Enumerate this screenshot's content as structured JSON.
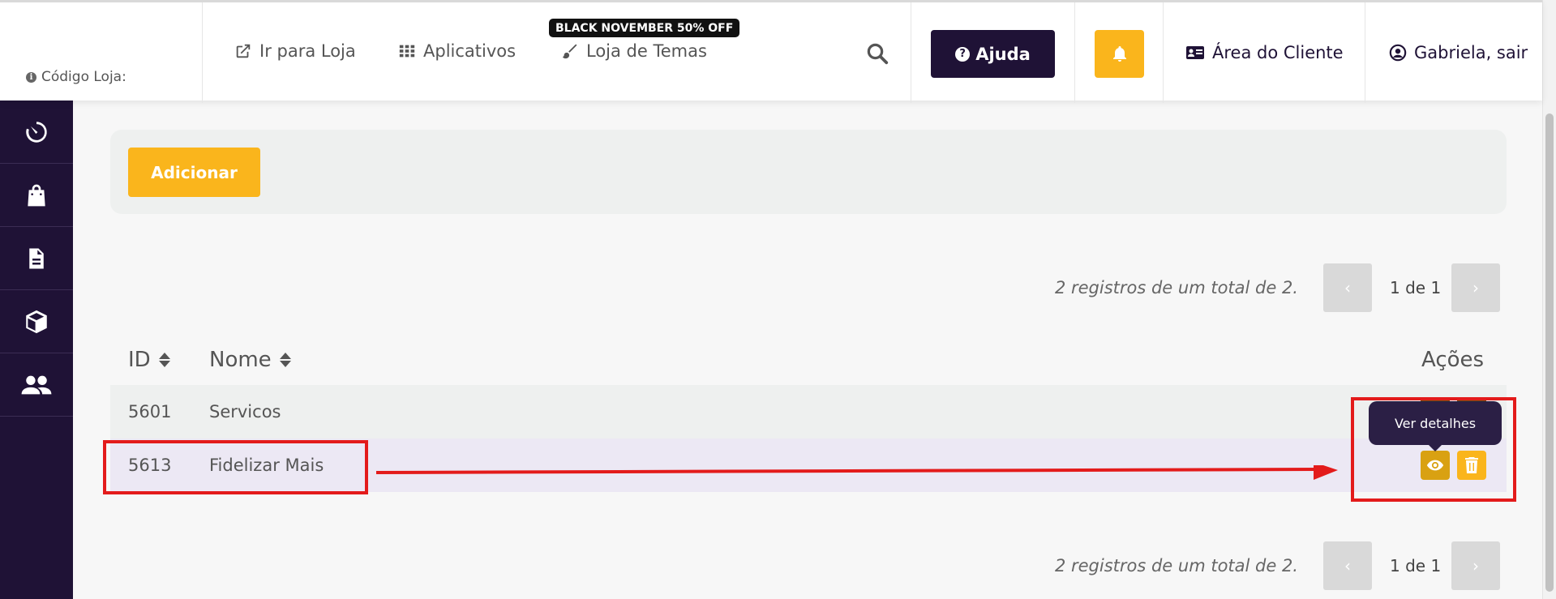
{
  "header": {
    "store_code_label": "Código Loja:",
    "nav": [
      {
        "label": "Ir para Loja",
        "icon": "external-link-icon"
      },
      {
        "label": "Aplicativos",
        "icon": "grid-icon"
      },
      {
        "label": "Loja de Temas",
        "icon": "brush-icon"
      }
    ],
    "promo_badge": "BLACK NOVEMBER 50% OFF",
    "help_label": "Ajuda",
    "client_area_label": "Área do Cliente",
    "user_label": "Gabriela, sair"
  },
  "sidebar": {
    "items": [
      {
        "icon": "dashboard-timer-icon"
      },
      {
        "icon": "shopping-bag-icon"
      },
      {
        "icon": "document-icon"
      },
      {
        "icon": "box-icon"
      },
      {
        "icon": "users-icon"
      }
    ]
  },
  "main": {
    "add_label": "Adicionar",
    "pagination": {
      "summary": "2 registros de um total de 2.",
      "page_text": "1 de 1",
      "prev": "‹",
      "next": "›"
    },
    "table": {
      "columns": [
        "ID",
        "Nome",
        "Ações"
      ],
      "rows": [
        {
          "id": "5601",
          "name": "Servicos"
        },
        {
          "id": "5613",
          "name": "Fidelizar Mais"
        }
      ]
    },
    "tooltip": "Ver detalhes"
  },
  "colors": {
    "brand_dark": "#1f1236",
    "accent_yellow": "#fab51c",
    "annotation_red": "#e31b1b",
    "row_highlight": "#ece8f4"
  }
}
